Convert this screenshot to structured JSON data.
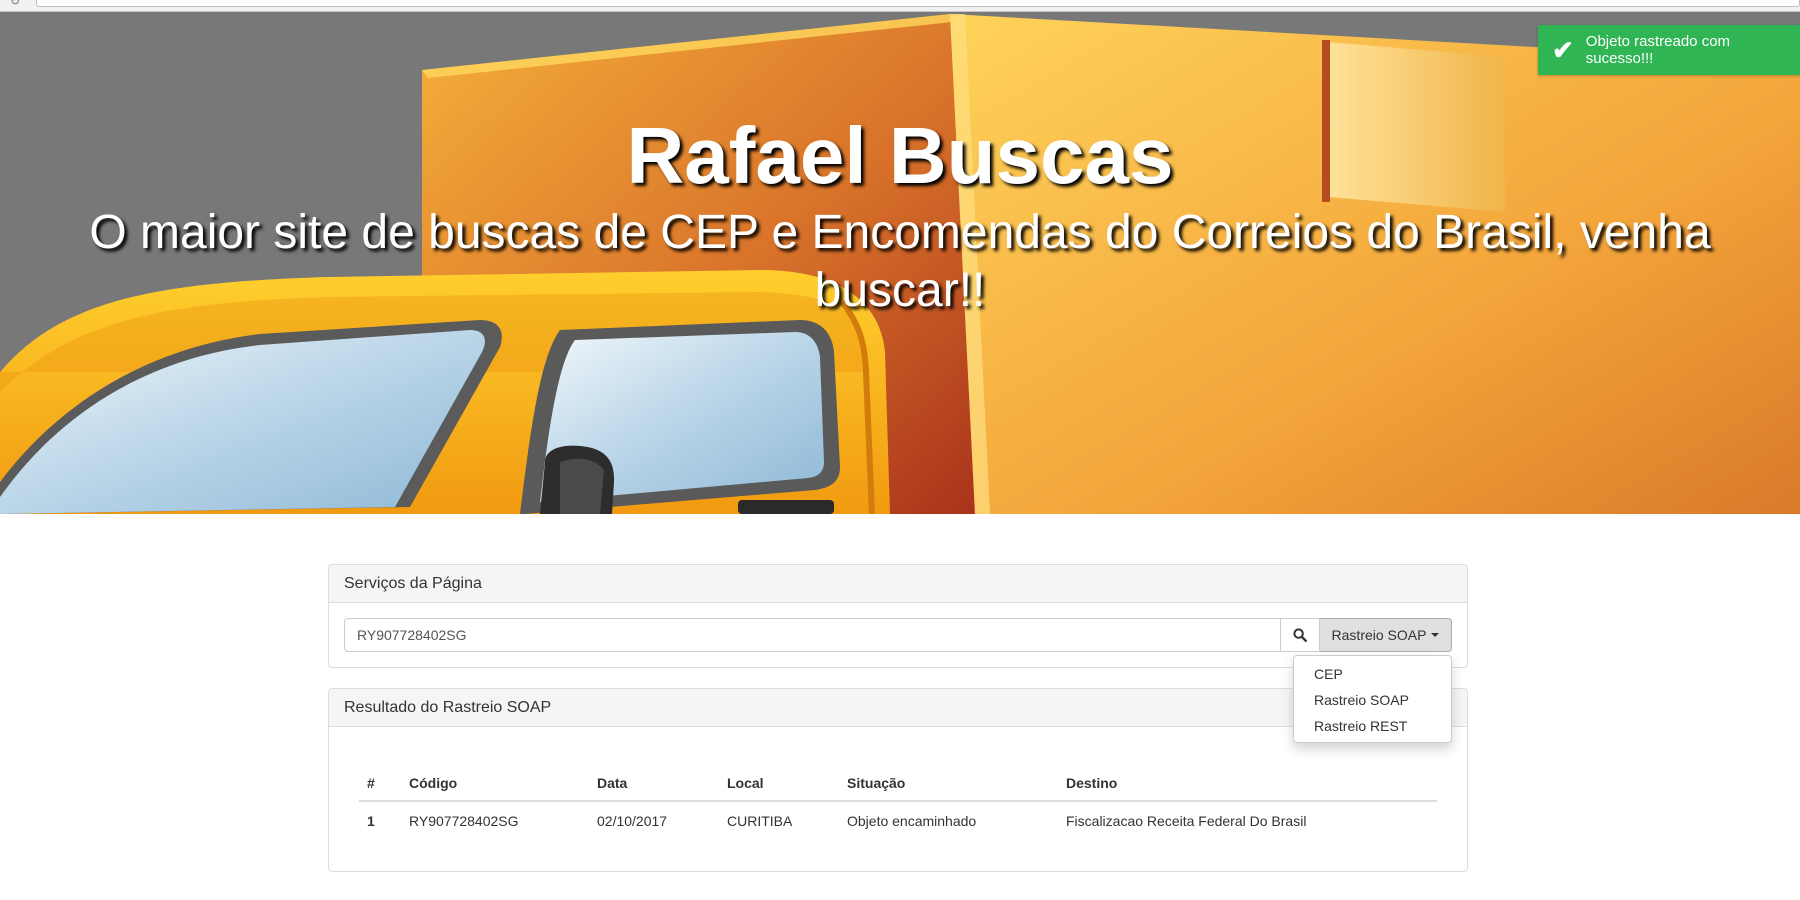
{
  "toast": {
    "icon": "check-icon",
    "message": "Objeto rastreado com sucesso!!!",
    "color": "#2fb553"
  },
  "hero": {
    "title": "Rafael Buscas",
    "subtitle": "O maior site de buscas de CEP e Encomendas do Correios do Brasil, venha buscar!!"
  },
  "services": {
    "heading": "Serviços da Página",
    "search_value": "RY907728402SG",
    "search_icon": "search-icon",
    "dropdown_label": "Rastreio SOAP",
    "menu": [
      "CEP",
      "Rastreio SOAP",
      "Rastreio REST"
    ]
  },
  "results": {
    "heading": "Resultado do Rastreio SOAP",
    "columns": [
      "#",
      "Código",
      "Data",
      "Local",
      "Situação",
      "Destino"
    ],
    "rows": [
      {
        "n": "1",
        "codigo": "RY907728402SG",
        "data": "02/10/2017",
        "local": "CURITIBA",
        "situacao": "Objeto encaminhado",
        "destino": "Fiscalizacao Receita Federal Do Brasil"
      }
    ]
  }
}
